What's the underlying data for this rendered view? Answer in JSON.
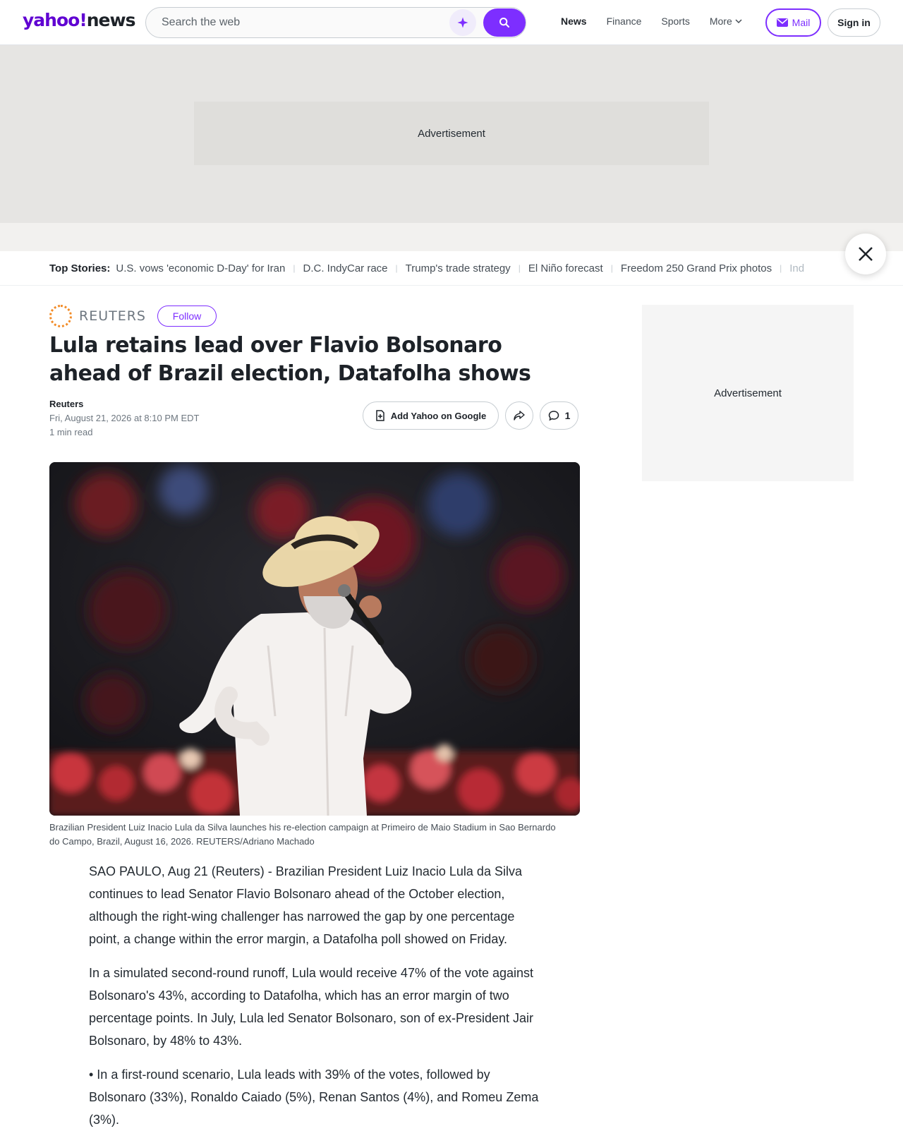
{
  "header": {
    "logo_main": "yahoo!",
    "logo_sub": "news",
    "search_placeholder": "Search the web",
    "nav": [
      "News",
      "Finance",
      "Sports",
      "More"
    ],
    "mail_label": "Mail",
    "signin_label": "Sign in"
  },
  "ads": {
    "top": "Advertisement",
    "right": "Advertisement"
  },
  "top_stories": {
    "label": "Top Stories:",
    "items": [
      "U.S. vows 'economic D-Day' for Iran",
      "D.C. IndyCar race",
      "Trump's trade strategy",
      "El Niño forecast",
      "Freedom 250 Grand Prix photos",
      "Ind"
    ]
  },
  "article": {
    "publisher": "REUTERS",
    "follow_label": "Follow",
    "headline": "Lula retains lead over Flavio Bolsonaro ahead of Brazil election, Datafolha shows",
    "author": "Reuters",
    "date": "Fri, August 21, 2026 at 8:10 PM EDT",
    "read_time": "1 min read",
    "add_google_label": "Add Yahoo on Google",
    "comment_count": "1",
    "caption": "Brazilian President Luiz Inacio Lula da Silva launches his re-election campaign at Primeiro de Maio Stadium in Sao Bernardo do Campo, Brazil, August 16, 2026. REUTERS/Adriano Machado",
    "paragraphs": [
      "SAO PAULO, Aug 21 (Reuters) - Brazilian President Luiz Inacio Lula da Silva continues to lead Senator Flavio Bolsonaro ahead of the October election, although the right-wing challenger has narrowed the gap by one percentage point, a change within the error margin, a Datafolha poll showed on Friday.",
      "In a simulated second-round runoff, Lula would receive 47% of the vote against Bolsonaro's 43%, according to Datafolha, which has an error margin of two percentage points. In July, Lula led Senator Bolsonaro, son of ex-President Jair Bolsonaro, by 48% to 43%.",
      "• In a first-round scenario, Lula leads with 39% of the votes, followed by Bolsonaro (33%), Ronaldo Caiado (5%), Renan Santos (4%), and Romeu Zema (3%)."
    ]
  },
  "colors": {
    "brand": "#6001d2",
    "accent": "#7d2eff"
  }
}
